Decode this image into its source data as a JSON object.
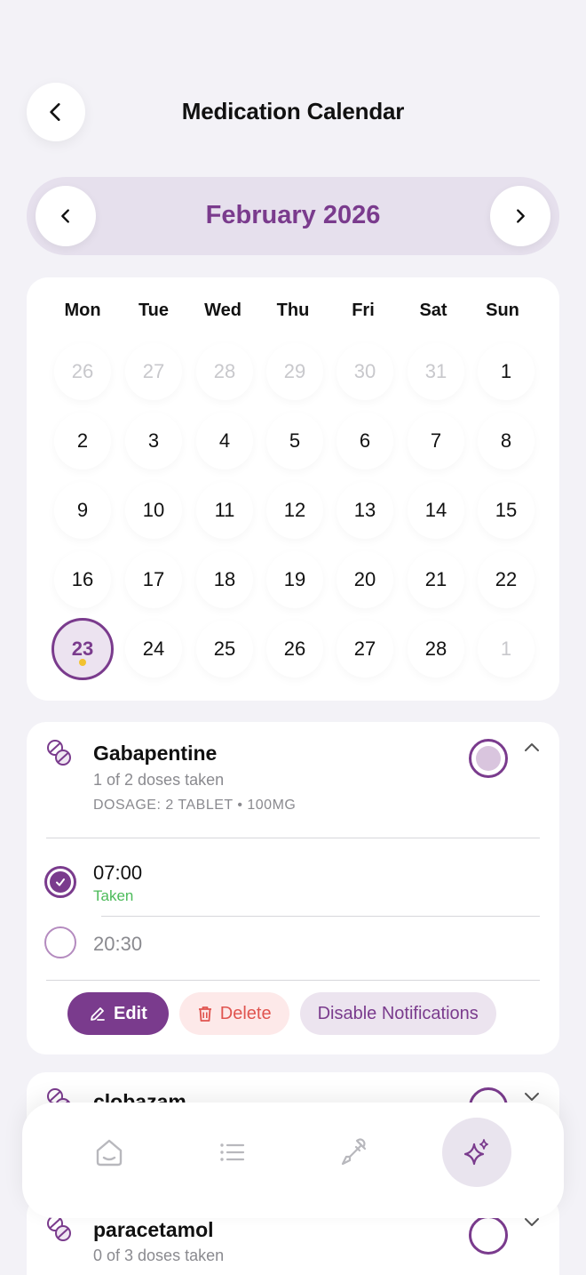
{
  "header": {
    "title": "Medication Calendar"
  },
  "month": {
    "label": "February 2026"
  },
  "weekdays": [
    "Mon",
    "Tue",
    "Wed",
    "Thu",
    "Fri",
    "Sat",
    "Sun"
  ],
  "calendar_weeks": [
    [
      "26",
      "27",
      "28",
      "29",
      "30",
      "31",
      "1"
    ],
    [
      "2",
      "3",
      "4",
      "5",
      "6",
      "7",
      "8"
    ],
    [
      "9",
      "10",
      "11",
      "12",
      "13",
      "14",
      "15"
    ],
    [
      "16",
      "17",
      "18",
      "19",
      "20",
      "21",
      "22"
    ],
    [
      "23",
      "24",
      "25",
      "26",
      "27",
      "28",
      "1"
    ]
  ],
  "selected_day": "23",
  "colors": {
    "accent": "#7a3b8d",
    "taken": "#4cbb5a",
    "delete": "#e0544f",
    "today_dot": "#f2c230"
  },
  "medications": [
    {
      "name": "Gabapentine",
      "summary": "1 of 2 doses taken",
      "dosage": "DOSAGE: 2 TABLET • 100MG",
      "progress_fraction": 0.5,
      "expanded": true,
      "doses": [
        {
          "time": "07:00",
          "status": "Taken"
        },
        {
          "time": "20:30",
          "status": ""
        }
      ],
      "actions": {
        "edit": "Edit",
        "delete": "Delete",
        "notifications": "Disable Notifications"
      }
    },
    {
      "name": "clobazam",
      "expanded": false
    },
    {
      "name": "paracetamol",
      "summary": "0 of 3 doses taken",
      "expanded": false
    }
  ],
  "tabs": [
    {
      "icon": "home-icon"
    },
    {
      "icon": "list-icon"
    },
    {
      "icon": "dropper-icon"
    },
    {
      "icon": "sparkles-icon",
      "active": true
    }
  ]
}
